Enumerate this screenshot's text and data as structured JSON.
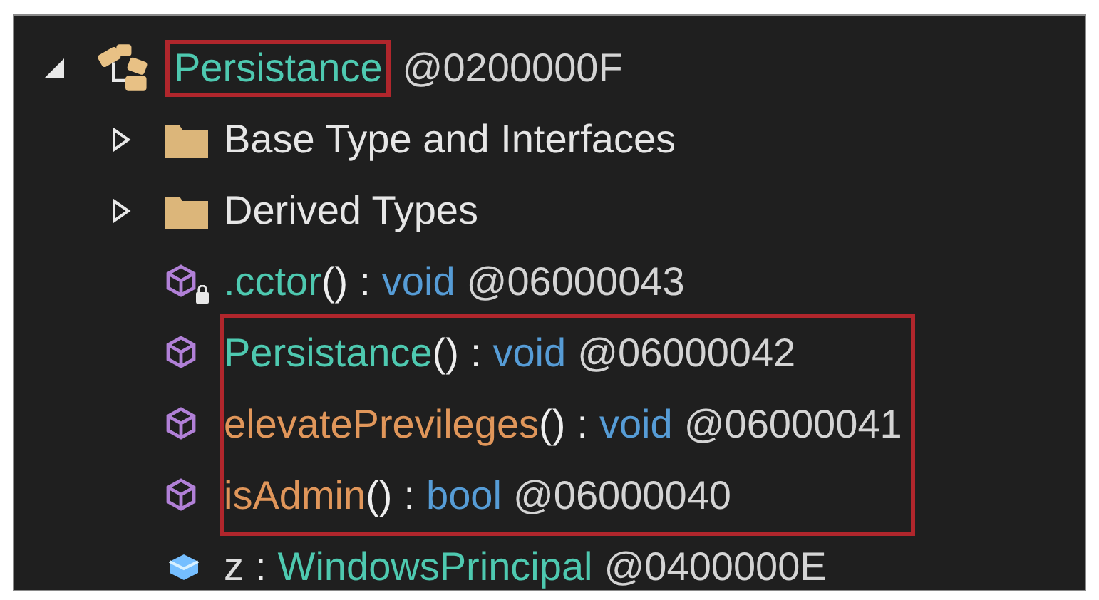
{
  "tree": {
    "kind": "class",
    "expanded": true,
    "highlighted": true,
    "name": "Persistance",
    "token": "@0200000F",
    "children": [
      {
        "kind": "folder",
        "expanded": false,
        "highlighted": false,
        "name": "Base Type and Interfaces"
      },
      {
        "kind": "folder",
        "expanded": false,
        "highlighted": false,
        "name": "Derived Types"
      },
      {
        "kind": "ctor",
        "private": true,
        "highlighted": false,
        "name": ".cctor",
        "params": "()",
        "separator": ":",
        "return_type": "void",
        "token": "@06000043"
      },
      {
        "kind": "ctor",
        "private": false,
        "highlighted": true,
        "name": "Persistance",
        "params": "()",
        "separator": ":",
        "return_type": "void",
        "token": "@06000042"
      },
      {
        "kind": "method",
        "private": false,
        "highlighted": true,
        "name": "elevatePrevileges",
        "params": "()",
        "separator": ":",
        "return_type": "void",
        "token": "@06000041"
      },
      {
        "kind": "method",
        "private": false,
        "highlighted": true,
        "name": "isAdmin",
        "params": "()",
        "separator": ":",
        "return_type": "bool",
        "token": "@06000040"
      },
      {
        "kind": "field",
        "private": false,
        "highlighted": false,
        "name": "z",
        "separator": ":",
        "return_type": "WindowsPrincipal",
        "token": "@0400000E"
      }
    ]
  }
}
